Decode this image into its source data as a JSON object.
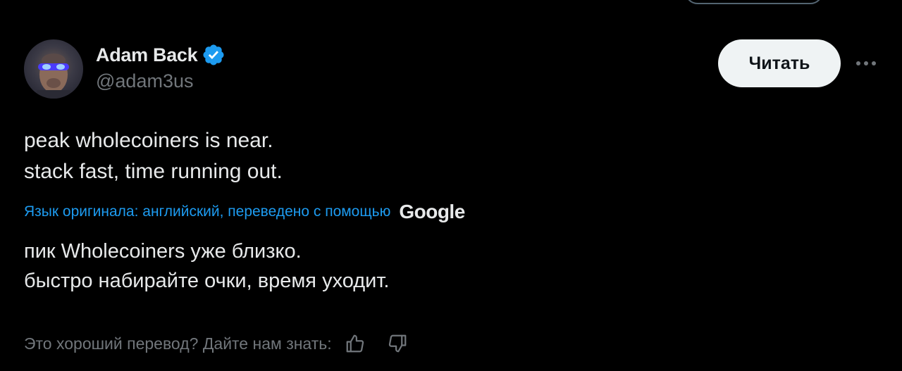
{
  "author": {
    "name": "Adam Back",
    "handle": "@adam3us",
    "verified": true,
    "verified_color": "#1d9bf0"
  },
  "actions": {
    "follow_label": "Читать",
    "more_icon": "more-horizontal-icon"
  },
  "tweet": {
    "text": "peak wholecoiners is near.\nstack fast, time running out."
  },
  "translation": {
    "note": "Язык оригинала: английский, переведено с помощью",
    "provider": "Google",
    "text": "пик Wholecoiners уже близко.\nбыстро набирайте очки, время уходит."
  },
  "feedback": {
    "prompt": "Это хороший перевод? Дайте нам знать:",
    "like_icon": "thumbs-up-icon",
    "dislike_icon": "thumbs-down-icon"
  },
  "colors": {
    "background": "#000000",
    "text_primary": "#e7e9ea",
    "text_secondary": "#71767b",
    "link": "#1d9bf0",
    "button_bg": "#eff3f4"
  }
}
